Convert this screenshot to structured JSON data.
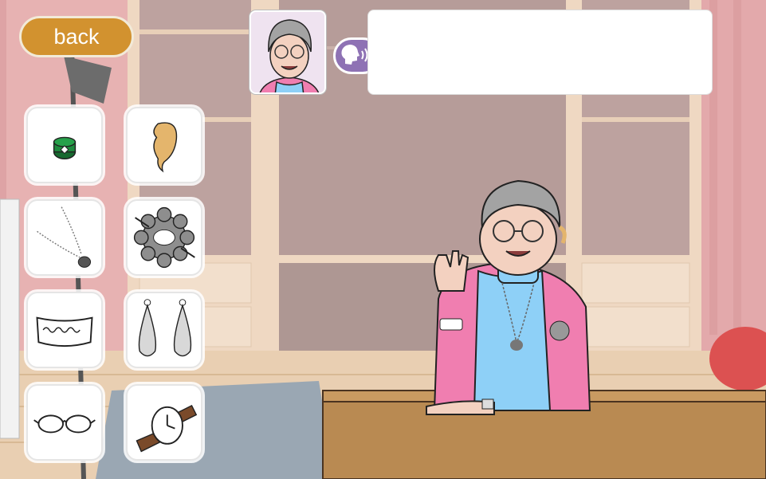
{
  "back_button": {
    "label": "back"
  },
  "dialog": {
    "text": ""
  },
  "items": [
    {
      "name": "ring",
      "icon": "ring-icon"
    },
    {
      "name": "hearing-aid",
      "icon": "hearing-aid-icon"
    },
    {
      "name": "necklace",
      "icon": "necklace-icon"
    },
    {
      "name": "brooch",
      "icon": "brooch-icon"
    },
    {
      "name": "bracelet",
      "icon": "bracelet-icon"
    },
    {
      "name": "earrings",
      "icon": "earrings-icon"
    },
    {
      "name": "glasses",
      "icon": "glasses-icon"
    },
    {
      "name": "watch",
      "icon": "watch-icon"
    }
  ],
  "colors": {
    "back_button": "#d2922f",
    "speak_button": "#8e72b4",
    "jacket": "#f07eb0",
    "sweater": "#8ed0f7",
    "desk": "#b98a52",
    "ring_green": "#1e8a3e"
  },
  "character": {
    "name": "grandmother",
    "icons": [
      "speaker-icon"
    ]
  }
}
